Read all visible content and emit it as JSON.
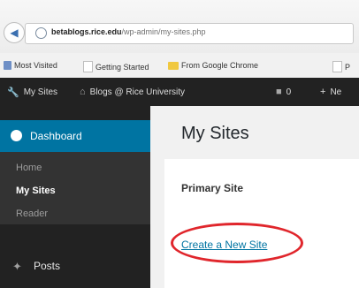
{
  "browser": {
    "url_domain": "betablogs.rice.edu",
    "url_path": "/wp-admin/my-sites.php",
    "bookmarks": [
      {
        "label": "Most Visited",
        "icon": "most-visited-icon"
      },
      {
        "label": "Getting Started",
        "icon": "page-icon"
      },
      {
        "label": "From Google Chrome",
        "icon": "folder-icon"
      },
      {
        "label": "P",
        "icon": "page-icon"
      }
    ]
  },
  "adminbar": {
    "my_sites": "My Sites",
    "site_name": "Blogs @ Rice University",
    "comments_count": "0",
    "new_label": "Ne"
  },
  "sidebar": {
    "dashboard": "Dashboard",
    "submenu": [
      "Home",
      "My Sites",
      "Reader"
    ],
    "posts": "Posts"
  },
  "main": {
    "title": "My Sites",
    "primary_site_label": "Primary Site",
    "create_link": "Create a New Site"
  },
  "colors": {
    "admin_bg": "#222222",
    "accent": "#0074a2",
    "highlight_circle": "#e0262c"
  }
}
